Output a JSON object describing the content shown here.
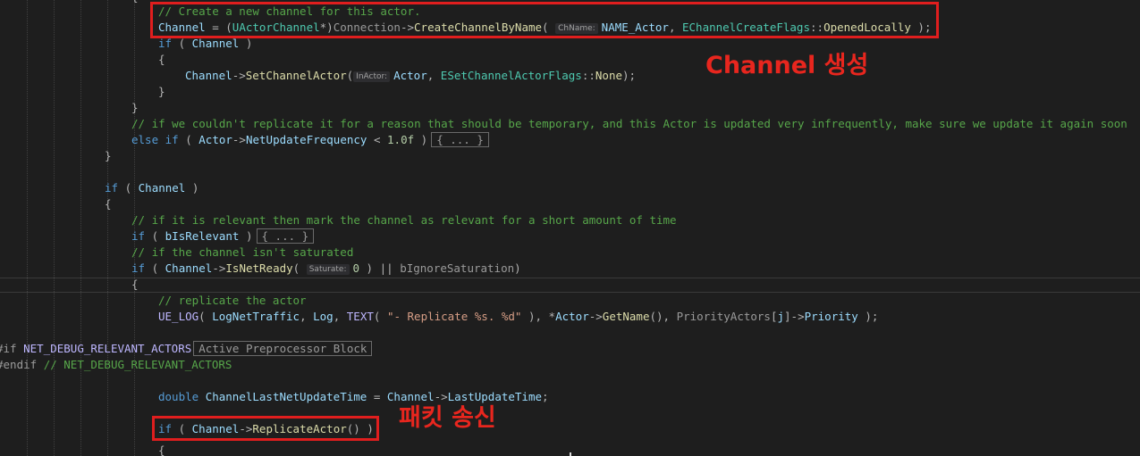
{
  "code": {
    "l1_comment": "// Create a new channel for this actor.",
    "l2": {
      "a": "Channel",
      "b": " = (",
      "c": "UActorChannel",
      "d": "*)",
      "e": "Connection",
      "f": "->",
      "g": "CreateChannelByName",
      "h": "( ",
      "hint": "ChName:",
      "i": "NAME_Actor",
      "j": ", ",
      "k": "EChannelCreateFlags",
      "l": "::",
      "m": "OpenedLocally",
      "n": " );"
    },
    "l3": {
      "a": "if",
      "b": " ( ",
      "c": "Channel",
      "d": " )"
    },
    "l4": "{",
    "l5": {
      "a": "Channel",
      "b": "->",
      "c": "SetChannelActor",
      "d": "(",
      "hint": "InActor:",
      "e": "Actor",
      "f": ", ",
      "g": "ESetChannelActorFlags",
      "h": "::",
      "i": "None",
      "j": ");"
    },
    "l6": "}",
    "l7": "}",
    "l8_comment": "// if we couldn't replicate it for a reason that should be temporary, and this Actor is updated very infrequently, make sure we update it again soon",
    "l9": {
      "a": "else if",
      "b": " ( ",
      "c": "Actor",
      "d": "->",
      "e": "NetUpdateFrequency",
      "f": " < ",
      "g": "1.0f",
      "h": " )",
      "fold": "{ ... }"
    },
    "l10": "}",
    "l12": {
      "a": "if",
      "b": " ( ",
      "c": "Channel",
      "d": " )"
    },
    "l13": "{",
    "l14_comment": "// if it is relevant then mark the channel as relevant for a short amount of time",
    "l15": {
      "a": "if",
      "b": " ( ",
      "c": "bIsRelevant",
      "d": " )",
      "fold": "{ ... }"
    },
    "l16_comment": "// if the channel isn't saturated",
    "l17": {
      "a": "if",
      "b": " ( ",
      "c": "Channel",
      "d": "->",
      "e": "IsNetReady",
      "f": "( ",
      "hint": "Saturate:",
      "g": "0",
      "h": " ) || ",
      "i": "bIgnoreSaturation",
      "j": ")"
    },
    "l18": "{",
    "l19_comment": "// replicate the actor",
    "l20": {
      "a": "UE_LOG",
      "b": "( ",
      "c": "LogNetTraffic",
      "d": ", ",
      "e": "Log",
      "f": ", ",
      "g": "TEXT",
      "h": "( ",
      "i": "\"- Replicate %s. %d\"",
      "j": " ), *",
      "k": "Actor",
      "l": "->",
      "m": "GetName",
      "n": "(), ",
      "o": "PriorityActors",
      "p": "[",
      "q": "j",
      "r": "]->",
      "s": "Priority",
      "t": " );"
    },
    "l22": {
      "a": "#if ",
      "b": "NET_DEBUG_RELEVANT_ACTORS",
      "block": "Active Preprocessor Block"
    },
    "l23": {
      "a": "#endif ",
      "b": "// NET_DEBUG_RELEVANT_ACTORS"
    },
    "l25": {
      "a": "double ",
      "b": "ChannelLastNetUpdateTime",
      "c": " = ",
      "d": "Channel",
      "e": "->",
      "f": "LastUpdateTime",
      "g": ";"
    },
    "l27": {
      "a": "if",
      "b": " ( ",
      "c": "Channel",
      "d": "->",
      "e": "ReplicateActor",
      "f": "() )"
    },
    "l28": "{"
  },
  "annotations": {
    "channel_create": "Channel 생성",
    "packet_send": "패킷 송신",
    "color": "#e8261e"
  }
}
